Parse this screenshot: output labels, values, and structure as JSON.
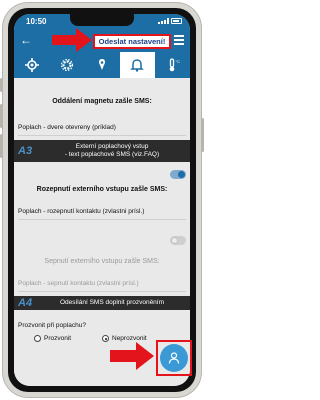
{
  "status_bar": {
    "time": "10:50"
  },
  "header": {
    "send_button_label": "Odeslat nastavení!"
  },
  "tabs": [
    {
      "icon": "gear-sliders-icon"
    },
    {
      "icon": "gear-icon"
    },
    {
      "icon": "pin-paint-icon"
    },
    {
      "icon": "alarm-bell-icon",
      "active": true
    },
    {
      "icon": "thermometer-icon"
    }
  ],
  "content": {
    "magnet_title": "Oddálení magnetu zašle SMS:",
    "magnet_value": "Poplach - dvere otevreny (príklad)",
    "section_a3": {
      "number": "A3",
      "line1": "Externí poplachový vstup",
      "line2": "- text poplachové SMS (viz.FAQ)"
    },
    "disconnect_title": "Rozepnutí externího vstupu zašle SMS:",
    "disconnect_value": "Poplach - rozepnutí kontaktu (zvlastni prísl.)",
    "connect_title": "Sepnutí externího vstupu zašle SMS:",
    "connect_value": "Poplach - sepnutí kontaktu (zvlastni prísl.)",
    "section_a4": {
      "number": "A4",
      "text": "Odesílání SMS doplnit prozvoněním"
    },
    "ring_question": "Prozvonit při poplachu?",
    "radio_ring": "Prozvonit",
    "radio_no_ring": "Neprozvonit"
  },
  "colors": {
    "accent": "#1c6ea4",
    "highlight": "#e3141b",
    "fab": "#3b9ad6",
    "section_header_bg": "#2c2c2c"
  }
}
